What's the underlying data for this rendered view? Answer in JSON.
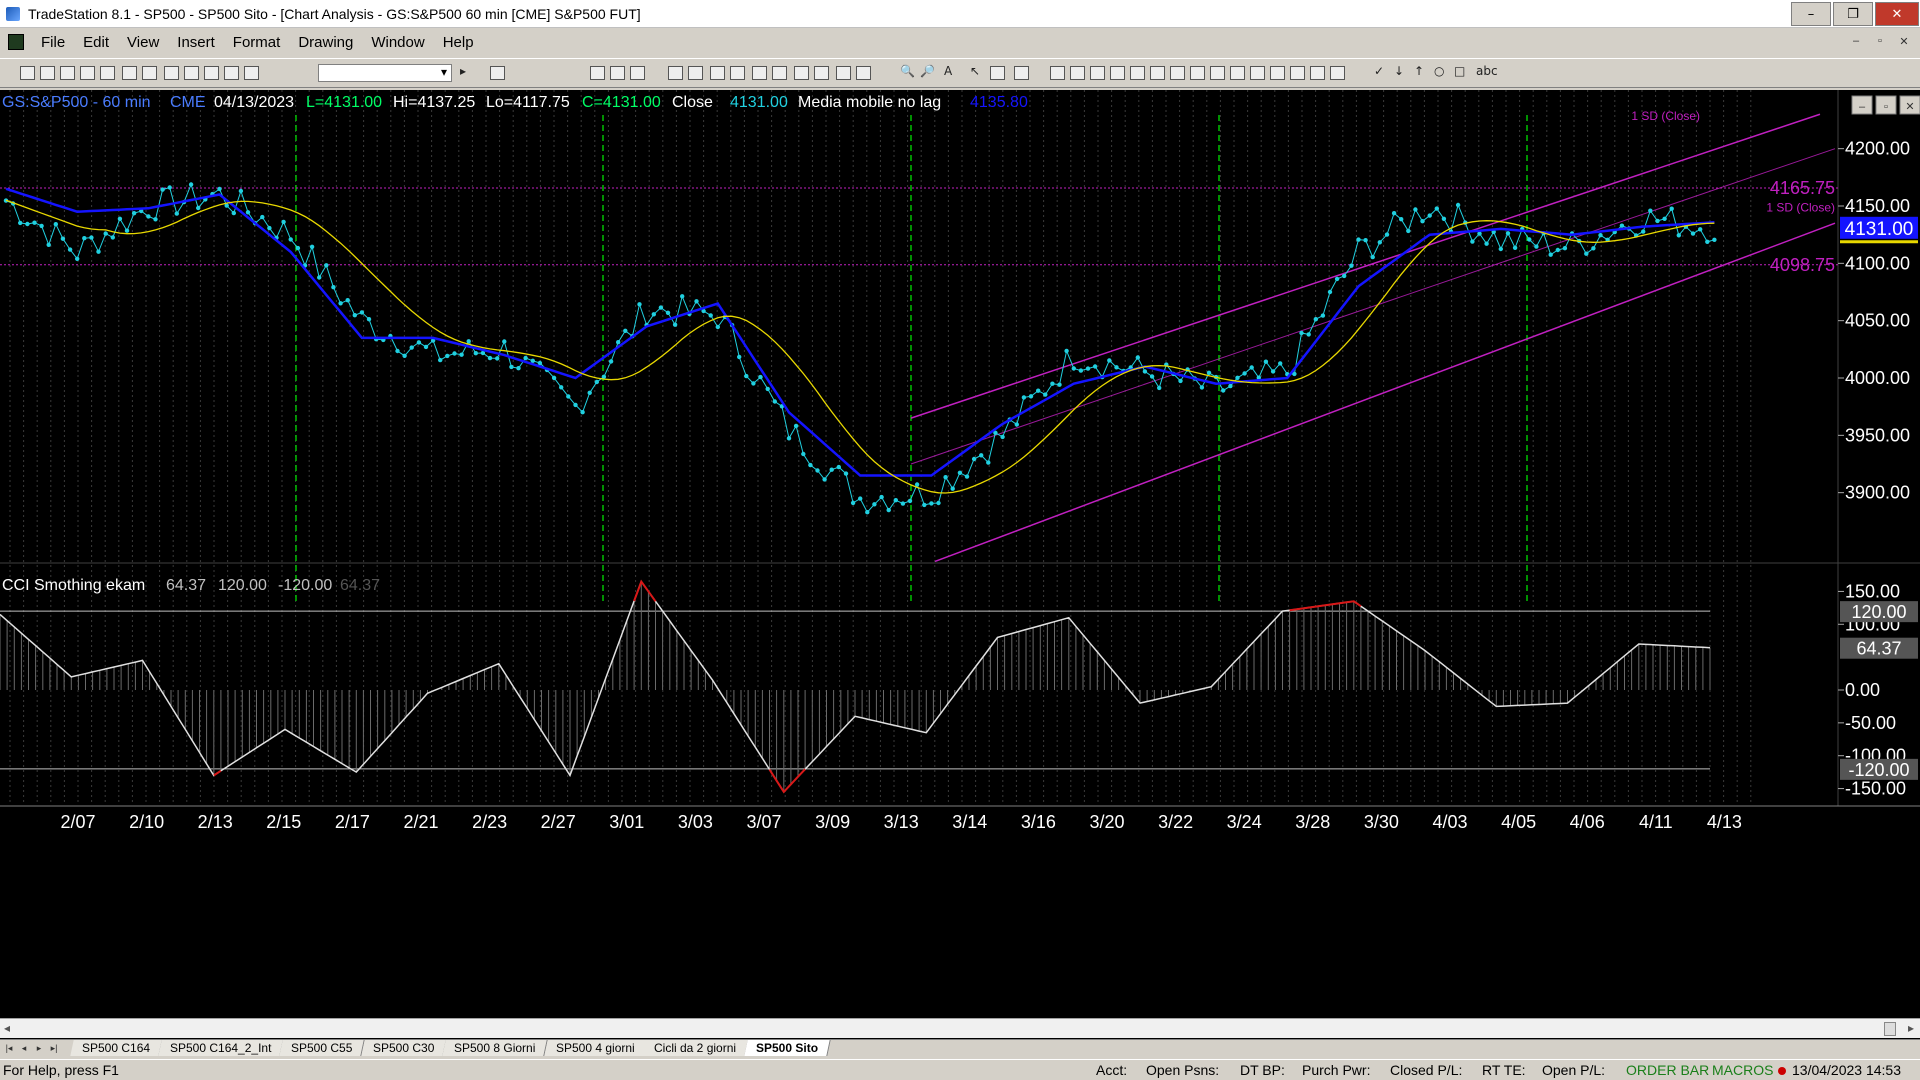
{
  "window": {
    "title": "TradeStation 8.1 - SP500 - SP500 Sito - [Chart Analysis - GS:S&P500  60 min  [CME] S&P500 FUT]",
    "buttons": [
      "–",
      "❐",
      "✕"
    ]
  },
  "menu": {
    "items": [
      "File",
      "Edit",
      "View",
      "Insert",
      "Format",
      "Drawing",
      "Window",
      "Help"
    ],
    "mdi_buttons": [
      "–",
      "▫",
      "✕"
    ]
  },
  "chart": {
    "legend": {
      "symbol": "GS:S&P500 - 60 min",
      "exchange": "CME",
      "date": "04/13/2023",
      "last": "L=4131.00",
      "high": "Hi=4137.25",
      "low": "Lo=4117.75",
      "close_value": "C=4131.00",
      "close_label": "Close",
      "close_num": "4131.00",
      "ma_label": "Media mobile no lag",
      "ma_value": "4135.80"
    },
    "price_labels": {
      "upper": "4165.75",
      "lower": "4098.75",
      "current": "4131.00",
      "sd_top": "1 SD (Close)",
      "sd_mid": "1 SD (Close)"
    },
    "cci_legend": {
      "name": "CCI Smothing ekam",
      "v1": "64.37",
      "v2": "120.00",
      "v3": "-120.00",
      "v4": "64.37"
    },
    "cci_labels": {
      "upper": "120.00",
      "lower": "-120.00",
      "current": "64.37"
    },
    "colors": {
      "price": "#20d0e0",
      "ma_blue": "#1414ff",
      "ma_yellow": "#e8d800",
      "channel": "#c020c0",
      "cycle": "#00c000",
      "cci_line": "#e0e0e0",
      "cci_extreme": "#d81818",
      "current_price_bg": "#1414ff"
    }
  },
  "chart_data": [
    {
      "type": "line",
      "title": "GS:S&P500 - 60 min",
      "x": [
        "2/07",
        "2/10",
        "2/13",
        "2/15",
        "2/17",
        "2/21",
        "2/23",
        "2/27",
        "3/01",
        "3/03",
        "3/07",
        "3/09",
        "3/13",
        "3/14",
        "3/16",
        "3/20",
        "3/22",
        "3/24",
        "3/28",
        "3/30",
        "4/03",
        "4/05",
        "4/06",
        "4/11",
        "4/13"
      ],
      "ylim": [
        3850,
        4225
      ],
      "yticks": [
        "4200.00",
        "4150.00",
        "4100.00",
        "4050.00",
        "4000.00",
        "3950.00",
        "3900.00"
      ],
      "series": [
        {
          "name": "Close",
          "values": [
            4155,
            4110,
            4150,
            4160,
            4125,
            4050,
            4020,
            4025,
            3975,
            4060,
            4055,
            3955,
            3895,
            3900,
            3950,
            4020,
            4005,
            3990,
            4005,
            4110,
            4150,
            4120,
            4115,
            4140,
            4131
          ]
        },
        {
          "name": "Media mobile no lag",
          "values": [
            4165,
            4145,
            4148,
            4160,
            4110,
            4035,
            4035,
            4020,
            4000,
            4045,
            4065,
            3970,
            3915,
            3915,
            3960,
            3995,
            4010,
            3995,
            4000,
            4080,
            4125,
            4130,
            4125,
            4132,
            4135.8
          ]
        }
      ]
    },
    {
      "type": "area",
      "title": "CCI Smothing ekam",
      "x": [
        "2/07",
        "2/10",
        "2/13",
        "2/15",
        "2/17",
        "2/21",
        "2/23",
        "2/27",
        "3/01",
        "3/03",
        "3/07",
        "3/09",
        "3/13",
        "3/14",
        "3/16",
        "3/20",
        "3/22",
        "3/24",
        "3/28",
        "3/30",
        "4/03",
        "4/05",
        "4/06",
        "4/11",
        "4/13"
      ],
      "ylim": [
        -175,
        175
      ],
      "yticks": [
        "150.00",
        "100.00",
        "0.00",
        "-50.00",
        "-100.00",
        "-150.00"
      ],
      "series": [
        {
          "name": "CCI Smothing ekam",
          "values": [
            115,
            20,
            45,
            -130,
            -60,
            -125,
            -5,
            40,
            -130,
            165,
            15,
            -155,
            -40,
            -65,
            80,
            110,
            -20,
            5,
            120,
            135,
            60,
            -25,
            -20,
            70,
            64.37
          ]
        }
      ]
    }
  ],
  "tabs": [
    "SP500 C164",
    "SP500 C164_2_Int",
    "SP500 C55",
    "SP500 C30",
    "SP500 8 Giorni",
    "SP500 4 giorni",
    "Cicli da 2 giorni",
    "SP500 Sito"
  ],
  "status": {
    "help": "For Help, press F1",
    "acct": "Acct:",
    "open_psns": "Open Psns:",
    "dt_bp": "DT BP:",
    "purch_pwr": "Purch Pwr:",
    "closed_pl": "Closed P/L:",
    "rt_te": "RT TE:",
    "open_pl": "Open P/L:",
    "order_bar": "ORDER BAR",
    "macros": "MACROS",
    "datetime": "13/04/2023 14:53"
  }
}
